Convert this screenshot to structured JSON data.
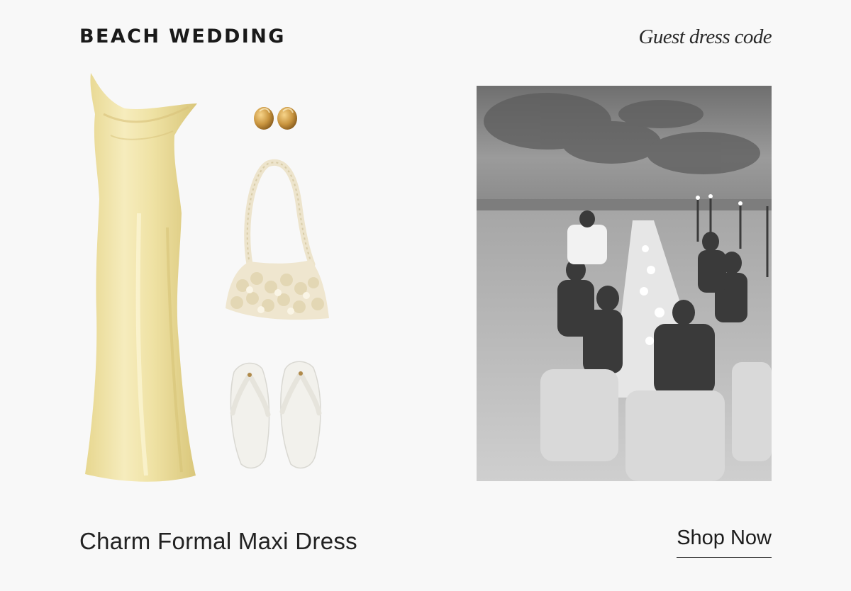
{
  "header": {
    "title": "BEACH WEDDING",
    "subtitle": "Guest dress code"
  },
  "collage": {
    "items": [
      {
        "icon": "satin-maxi-dress",
        "color": "#efe2a4"
      },
      {
        "icon": "gold-earrings",
        "color": "#c9953f"
      },
      {
        "icon": "sequin-shoulder-bag",
        "color": "#efe6cf"
      },
      {
        "icon": "white-flip-flops",
        "color": "#f2f1ec"
      }
    ]
  },
  "photo": {
    "scene": "beach-dinner-photo",
    "tone": "black-and-white"
  },
  "product": {
    "name": "Charm Formal Maxi Dress"
  },
  "cta": {
    "label": "Shop Now"
  }
}
